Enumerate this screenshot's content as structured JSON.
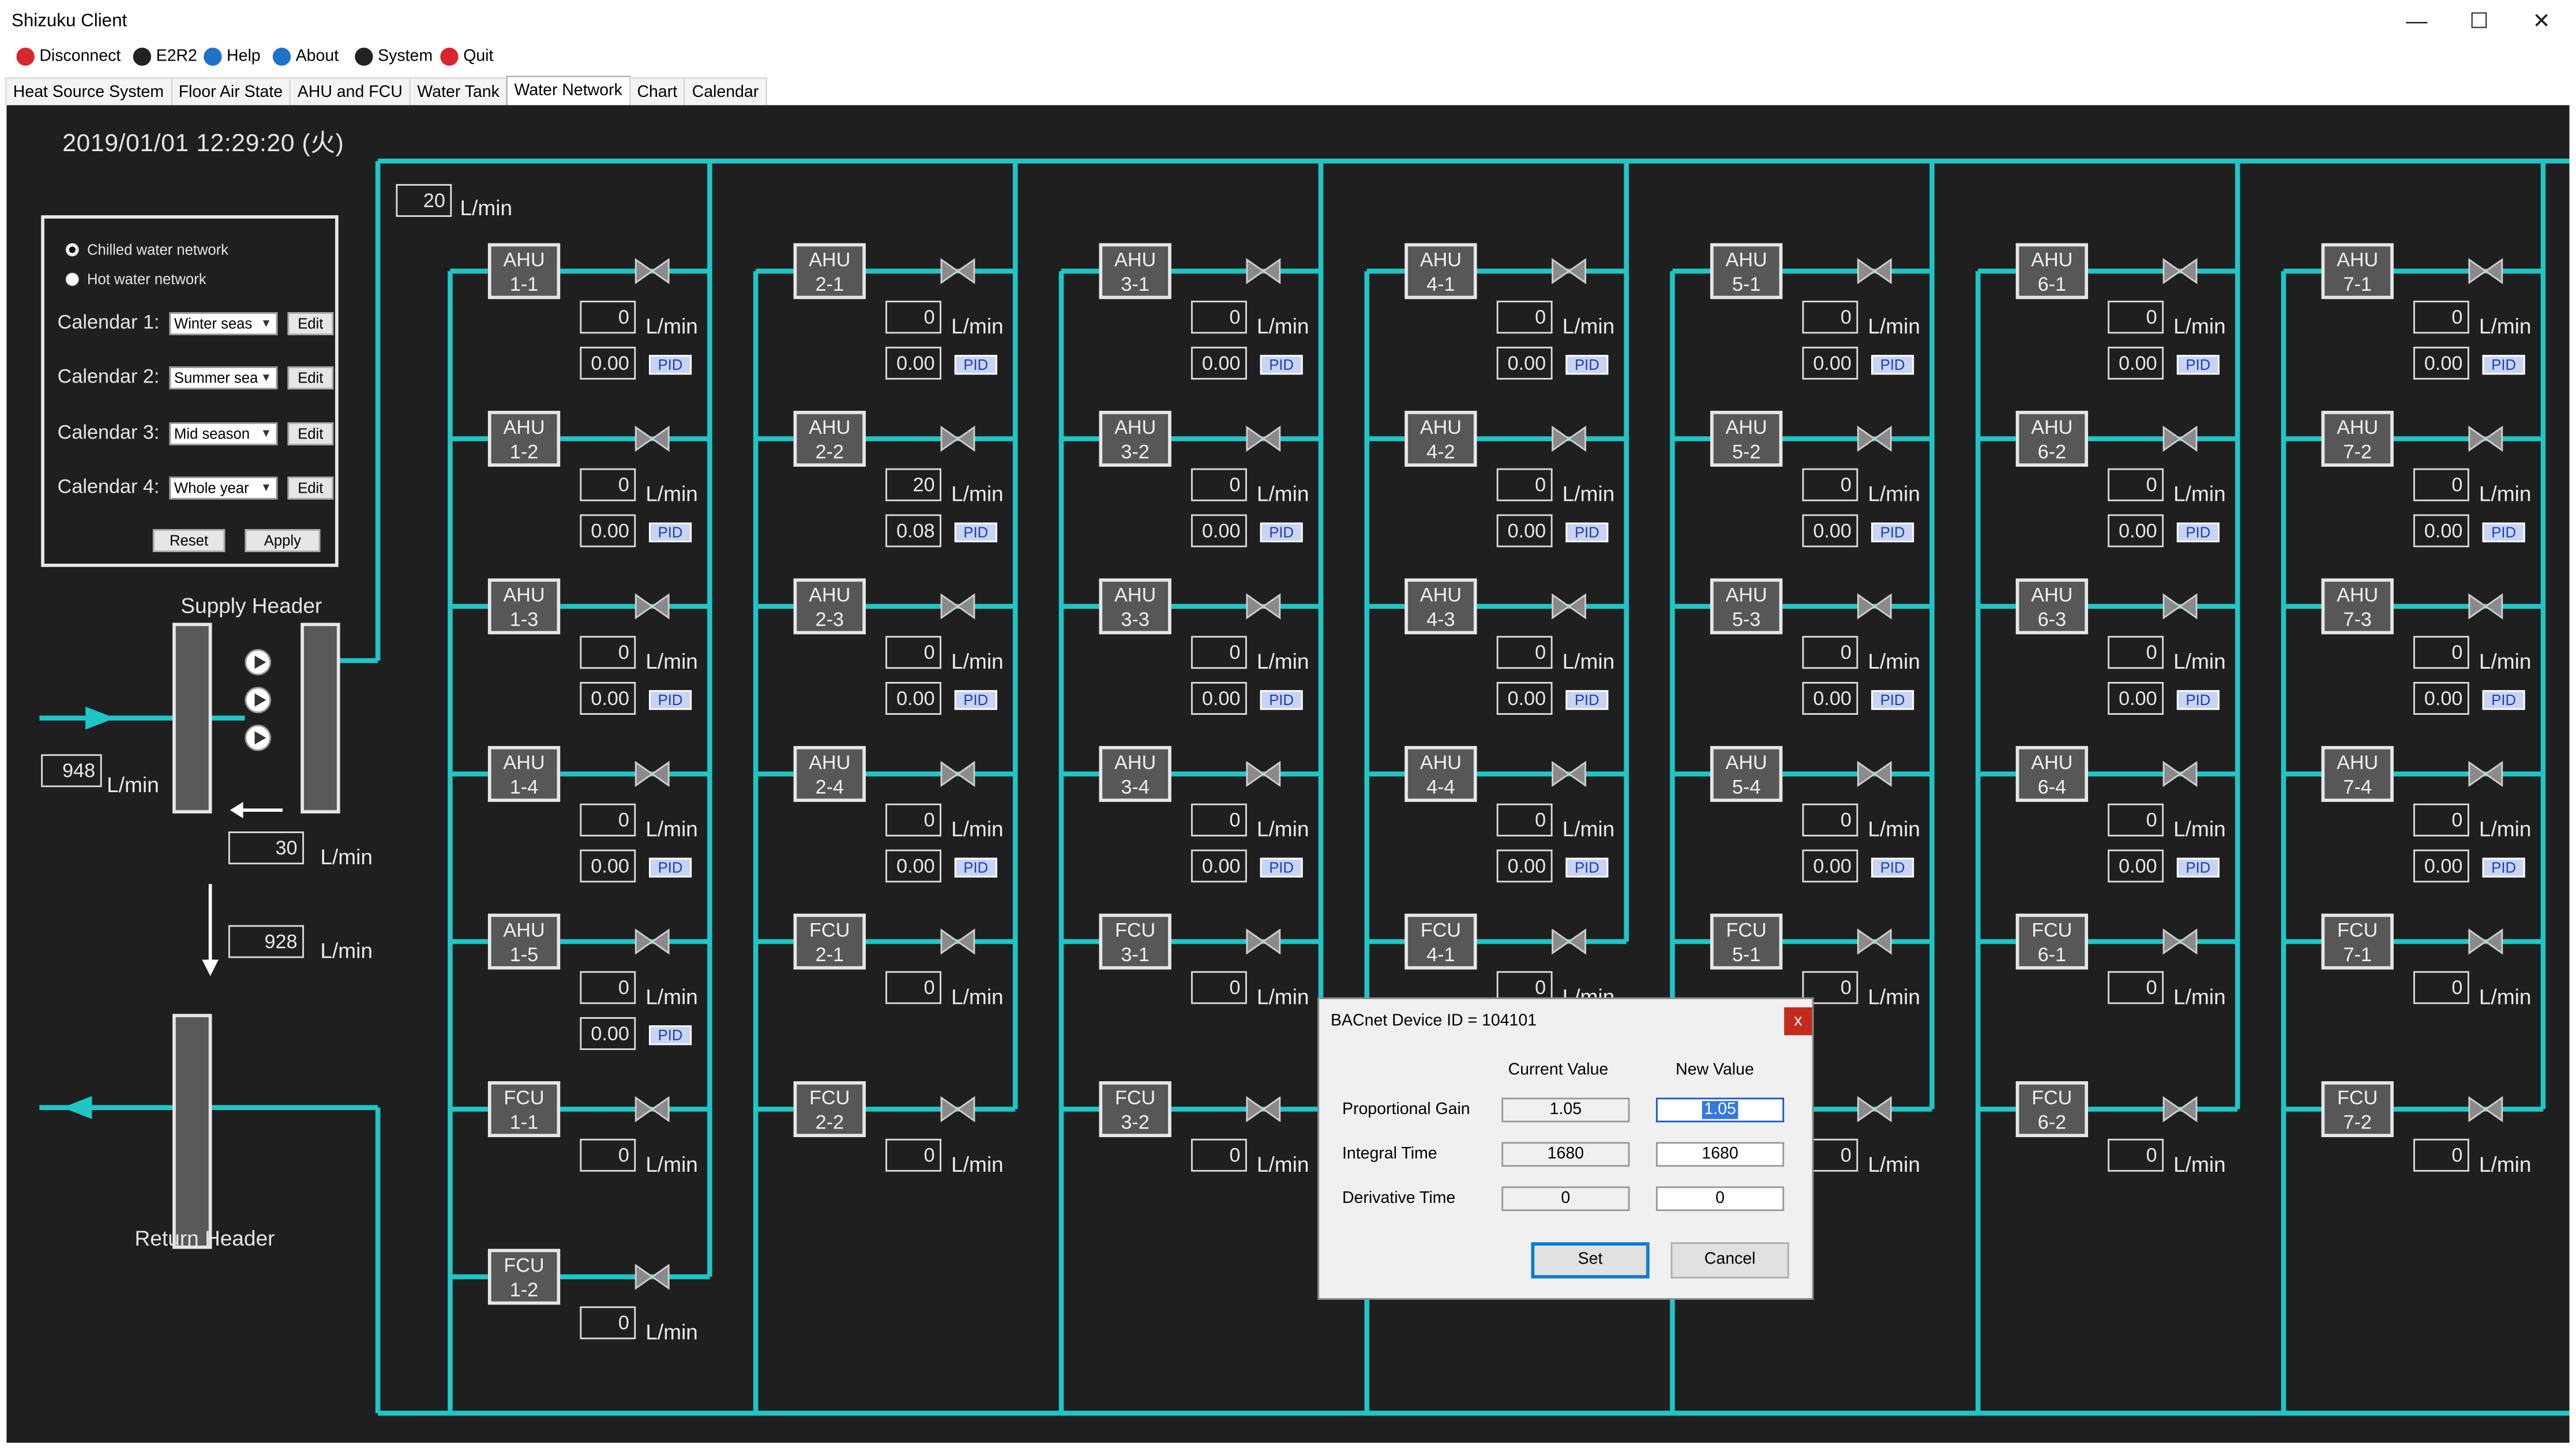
{
  "window": {
    "title": "Shizuku Client",
    "minimize": "—",
    "maximize": "☐",
    "close": "✕"
  },
  "toolbar": [
    {
      "label": "Disconnect",
      "icon": "disconnect-icon",
      "color": "#d7262c"
    },
    {
      "label": "E2R2",
      "icon": "e2r2-icon",
      "color": "#222222"
    },
    {
      "label": "Help",
      "icon": "help-icon",
      "color": "#1e72c8"
    },
    {
      "label": "About",
      "icon": "info-icon",
      "color": "#1e72c8"
    },
    {
      "label": "System",
      "icon": "user-icon",
      "color": "#222222"
    },
    {
      "label": "Quit",
      "icon": "quit-icon",
      "color": "#d7262c"
    }
  ],
  "tabs": [
    "Heat Source System",
    "Floor Air State",
    "AHU and FCU",
    "Water Tank",
    "Water Network",
    "Chart",
    "Calendar"
  ],
  "active_tab": "Water Network",
  "datetime": "2019/01/01 12:29:20 (火)",
  "network": {
    "options": [
      "Chilled water network",
      "Hot water network"
    ],
    "selected": "Chilled water network"
  },
  "calendars": [
    {
      "label": "Calendar 1:",
      "value": "Winter seas",
      "edit": "Edit"
    },
    {
      "label": "Calendar 2:",
      "value": "Summer sea",
      "edit": "Edit"
    },
    {
      "label": "Calendar 3:",
      "value": "Mid season",
      "edit": "Edit"
    },
    {
      "label": "Calendar 4:",
      "value": "Whole year",
      "edit": "Edit"
    }
  ],
  "calendar_buttons": {
    "reset": "Reset",
    "apply": "Apply"
  },
  "supply_header": {
    "label": "Supply Header",
    "flow": "948",
    "bypass": "30",
    "main_flow": "20"
  },
  "return_header": {
    "label": "Return Header",
    "flow": "928"
  },
  "unit_text": "L/min",
  "pid_label": "PID",
  "accent_color": "#1fc6c6",
  "columns": [
    {
      "units": [
        {
          "name1": "AHU",
          "name2": "1-1",
          "flow": "0",
          "value": "0.00",
          "pid": true
        },
        {
          "name1": "AHU",
          "name2": "1-2",
          "flow": "0",
          "value": "0.00",
          "pid": true
        },
        {
          "name1": "AHU",
          "name2": "1-3",
          "flow": "0",
          "value": "0.00",
          "pid": true
        },
        {
          "name1": "AHU",
          "name2": "1-4",
          "flow": "0",
          "value": "0.00",
          "pid": true
        },
        {
          "name1": "AHU",
          "name2": "1-5",
          "flow": "0",
          "value": "0.00",
          "pid": true
        },
        {
          "name1": "FCU",
          "name2": "1-1",
          "flow": "0"
        },
        {
          "name1": "FCU",
          "name2": "1-2",
          "flow": "0"
        }
      ]
    },
    {
      "units": [
        {
          "name1": "AHU",
          "name2": "2-1",
          "flow": "0",
          "value": "0.00",
          "pid": true
        },
        {
          "name1": "AHU",
          "name2": "2-2",
          "flow": "20",
          "value": "0.08",
          "pid": true
        },
        {
          "name1": "AHU",
          "name2": "2-3",
          "flow": "0",
          "value": "0.00",
          "pid": true
        },
        {
          "name1": "AHU",
          "name2": "2-4",
          "flow": "0",
          "value": "0.00",
          "pid": true
        },
        {
          "name1": "FCU",
          "name2": "2-1",
          "flow": "0"
        },
        {
          "name1": "FCU",
          "name2": "2-2",
          "flow": "0"
        }
      ]
    },
    {
      "units": [
        {
          "name1": "AHU",
          "name2": "3-1",
          "flow": "0",
          "value": "0.00",
          "pid": true
        },
        {
          "name1": "AHU",
          "name2": "3-2",
          "flow": "0",
          "value": "0.00",
          "pid": true
        },
        {
          "name1": "AHU",
          "name2": "3-3",
          "flow": "0",
          "value": "0.00",
          "pid": true
        },
        {
          "name1": "AHU",
          "name2": "3-4",
          "flow": "0",
          "value": "0.00",
          "pid": true
        },
        {
          "name1": "FCU",
          "name2": "3-1",
          "flow": "0"
        },
        {
          "name1": "FCU",
          "name2": "3-2",
          "flow": "0"
        }
      ]
    },
    {
      "units": [
        {
          "name1": "AHU",
          "name2": "4-1",
          "flow": "0",
          "value": "0.00",
          "pid": true
        },
        {
          "name1": "AHU",
          "name2": "4-2",
          "flow": "0",
          "value": "0.00",
          "pid": true
        },
        {
          "name1": "AHU",
          "name2": "4-3",
          "flow": "0",
          "value": "0.00",
          "pid": true
        },
        {
          "name1": "AHU",
          "name2": "4-4",
          "flow": "0",
          "value": "0.00",
          "pid": true
        },
        {
          "name1": "FCU",
          "name2": "4-1",
          "flow": "0"
        }
      ]
    },
    {
      "units": [
        {
          "name1": "AHU",
          "name2": "5-1",
          "flow": "0",
          "value": "0.00",
          "pid": true
        },
        {
          "name1": "AHU",
          "name2": "5-2",
          "flow": "0",
          "value": "0.00",
          "pid": true
        },
        {
          "name1": "AHU",
          "name2": "5-3",
          "flow": "0",
          "value": "0.00",
          "pid": true
        },
        {
          "name1": "AHU",
          "name2": "5-4",
          "flow": "0",
          "value": "0.00",
          "pid": true
        },
        {
          "name1": "FCU",
          "name2": "5-1",
          "flow": "0"
        },
        {
          "name1": "",
          "name2": "",
          "flow": "0",
          "hidden_unit": true
        }
      ]
    },
    {
      "units": [
        {
          "name1": "AHU",
          "name2": "6-1",
          "flow": "0",
          "value": "0.00",
          "pid": true
        },
        {
          "name1": "AHU",
          "name2": "6-2",
          "flow": "0",
          "value": "0.00",
          "pid": true
        },
        {
          "name1": "AHU",
          "name2": "6-3",
          "flow": "0",
          "value": "0.00",
          "pid": true
        },
        {
          "name1": "AHU",
          "name2": "6-4",
          "flow": "0",
          "value": "0.00",
          "pid": true
        },
        {
          "name1": "FCU",
          "name2": "6-1",
          "flow": "0"
        },
        {
          "name1": "FCU",
          "name2": "6-2",
          "flow": "0"
        }
      ]
    },
    {
      "units": [
        {
          "name1": "AHU",
          "name2": "7-1",
          "flow": "0",
          "value": "0.00",
          "pid": true
        },
        {
          "name1": "AHU",
          "name2": "7-2",
          "flow": "0",
          "value": "0.00",
          "pid": true
        },
        {
          "name1": "AHU",
          "name2": "7-3",
          "flow": "0",
          "value": "0.00",
          "pid": true
        },
        {
          "name1": "AHU",
          "name2": "7-4",
          "flow": "0",
          "value": "0.00",
          "pid": true
        },
        {
          "name1": "FCU",
          "name2": "7-1",
          "flow": "0"
        },
        {
          "name1": "FCU",
          "name2": "7-2",
          "flow": "0"
        }
      ]
    }
  ],
  "dialog": {
    "title": "BACnet Device ID = 104101",
    "close": "x",
    "col_current": "Current Value",
    "col_new": "New Value",
    "rows": [
      {
        "label": "Proportional Gain",
        "current": "1.05",
        "new": "1.05"
      },
      {
        "label": "Integral Time",
        "current": "1680",
        "new": "1680"
      },
      {
        "label": "Derivative Time",
        "current": "0",
        "new": "0"
      }
    ],
    "set": "Set",
    "cancel": "Cancel"
  }
}
